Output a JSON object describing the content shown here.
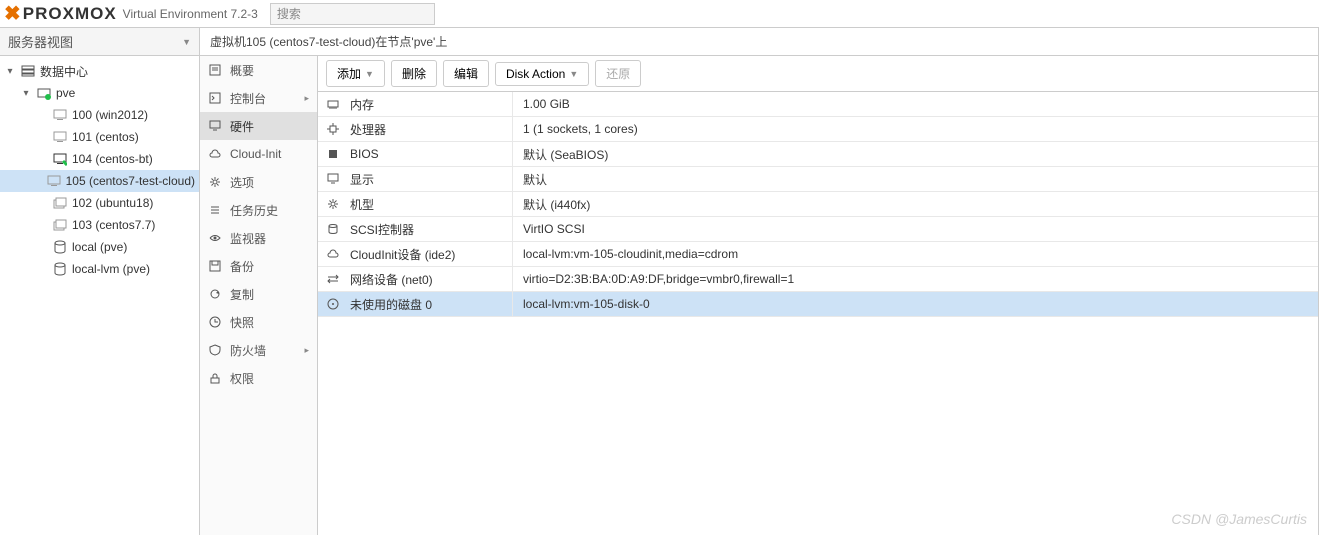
{
  "header": {
    "brand": "PROXMOX",
    "version": "Virtual Environment 7.2-3",
    "search_placeholder": "搜索"
  },
  "view_selector": "服务器视图",
  "tree": [
    {
      "id": "dc",
      "label": "数据中心",
      "depth": 0,
      "icon": "server",
      "expandable": true
    },
    {
      "id": "pve",
      "label": "pve",
      "depth": 1,
      "icon": "node-green",
      "expandable": true
    },
    {
      "id": "100",
      "label": "100 (win2012)",
      "depth": 2,
      "icon": "vm-off"
    },
    {
      "id": "101",
      "label": "101 (centos)",
      "depth": 2,
      "icon": "vm-off"
    },
    {
      "id": "104",
      "label": "104 (centos-bt)",
      "depth": 2,
      "icon": "vm-on"
    },
    {
      "id": "105",
      "label": "105 (centos7-test-cloud)",
      "depth": 2,
      "icon": "vm-off",
      "selected": true
    },
    {
      "id": "102",
      "label": "102 (ubuntu18)",
      "depth": 2,
      "icon": "ct"
    },
    {
      "id": "103",
      "label": "103 (centos7.7)",
      "depth": 2,
      "icon": "ct"
    },
    {
      "id": "local",
      "label": "local (pve)",
      "depth": 2,
      "icon": "storage"
    },
    {
      "id": "local-lvm",
      "label": "local-lvm (pve)",
      "depth": 2,
      "icon": "storage"
    }
  ],
  "breadcrumb": "虚拟机105 (centos7-test-cloud)在节点'pve'上",
  "subnav": [
    {
      "id": "summary",
      "label": "概要",
      "icon": "note"
    },
    {
      "id": "console",
      "label": "控制台",
      "icon": "terminal",
      "arrow": true
    },
    {
      "id": "hardware",
      "label": "硬件",
      "icon": "monitor",
      "selected": true
    },
    {
      "id": "cloudinit",
      "label": "Cloud-Init",
      "icon": "cloud"
    },
    {
      "id": "options",
      "label": "选项",
      "icon": "gear"
    },
    {
      "id": "taskhist",
      "label": "任务历史",
      "icon": "list"
    },
    {
      "id": "monitor",
      "label": "监视器",
      "icon": "eye"
    },
    {
      "id": "backup",
      "label": "备份",
      "icon": "save"
    },
    {
      "id": "replication",
      "label": "复制",
      "icon": "sync"
    },
    {
      "id": "snapshot",
      "label": "快照",
      "icon": "history"
    },
    {
      "id": "firewall",
      "label": "防火墙",
      "icon": "shield",
      "arrow": true
    },
    {
      "id": "permissions",
      "label": "权限",
      "icon": "lock"
    }
  ],
  "toolbar": {
    "add": "添加",
    "remove": "删除",
    "edit": "编辑",
    "diskaction": "Disk Action",
    "revert": "还原"
  },
  "hardware": [
    {
      "icon": "memory",
      "key": "内存",
      "val": "1.00 GiB"
    },
    {
      "icon": "cpu",
      "key": "处理器",
      "val": "1 (1 sockets, 1 cores)"
    },
    {
      "icon": "bios",
      "key": "BIOS",
      "val": "默认 (SeaBIOS)"
    },
    {
      "icon": "monitor",
      "key": "显示",
      "val": "默认"
    },
    {
      "icon": "gear",
      "key": "机型",
      "val": "默认 (i440fx)"
    },
    {
      "icon": "db",
      "key": "SCSI控制器",
      "val": "VirtIO SCSI"
    },
    {
      "icon": "cloud",
      "key": "CloudInit设备 (ide2)",
      "val": "local-lvm:vm-105-cloudinit,media=cdrom"
    },
    {
      "icon": "net",
      "key": "网络设备 (net0)",
      "val": "virtio=D2:3B:BA:0D:A9:DF,bridge=vmbr0,firewall=1"
    },
    {
      "icon": "disk",
      "key": "未使用的磁盘 0",
      "val": "local-lvm:vm-105-disk-0",
      "selected": true
    }
  ],
  "watermark": "CSDN @JamesCurtis"
}
